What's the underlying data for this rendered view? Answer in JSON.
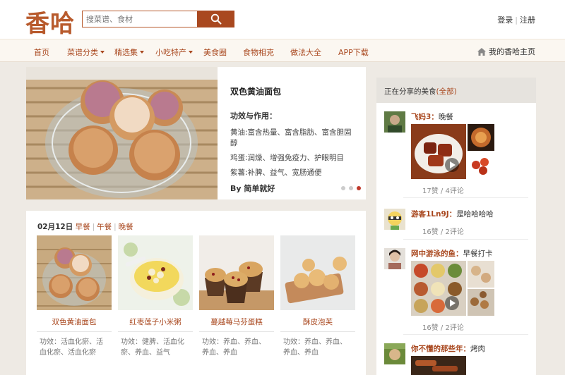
{
  "header": {
    "logo": "香哈",
    "search_placeholder": "搜菜谱、食材",
    "login": "登录",
    "register": "注册"
  },
  "nav": {
    "items": [
      {
        "label": "首页"
      },
      {
        "label": "菜谱分类",
        "dropdown": true
      },
      {
        "label": "精选集",
        "dropdown": true
      },
      {
        "label": "小吃特产",
        "dropdown": true
      },
      {
        "label": "美食圈"
      },
      {
        "label": "食物相克"
      },
      {
        "label": "做法大全"
      },
      {
        "label": "APP下载"
      }
    ],
    "home_link": "我的香哈主页"
  },
  "hero": {
    "title": "双色黄油面包",
    "subtitle": "功效与作用：",
    "lines": [
      "黄油:富含热量、富含脂肪、富含胆固醇",
      "鸡蛋:润燥、增强免疫力、护眼明目",
      "紫薯:补脾、益气、宽肠通便"
    ],
    "author": "By 简单就好",
    "slides": 3,
    "active_slide": 3
  },
  "meals": {
    "date": "02月12日",
    "tabs": [
      "早餐",
      "午餐",
      "晚餐"
    ],
    "items": [
      {
        "name": "双色黄油面包",
        "desc": "功效：活血化瘀、活血化瘀、活血化瘀"
      },
      {
        "name": "红枣莲子小米粥",
        "desc": "功效：健脾、活血化瘀、养血、益气"
      },
      {
        "name": "蔓越莓马芬蛋糕",
        "desc": "功效：养血、养血、养血、养血"
      },
      {
        "name": "酥皮泡芙",
        "desc": "功效：养血、养血、养血、养血"
      }
    ]
  },
  "sidebar": {
    "title": "正在分享的美食",
    "all_link": "(全部)",
    "shares": [
      {
        "user": "飞妈3：",
        "text": "晚餐",
        "likes": "17赞",
        "comments": "4评论"
      },
      {
        "user": "游客1Ln9J：",
        "text": "是哈哈哈哈",
        "likes": "16赞",
        "comments": "2评论"
      },
      {
        "user": "网中游泳的鱼：",
        "text": "早餐打卡",
        "likes": "16赞",
        "comments": "2评论"
      },
      {
        "user": "你不懂的那些年：",
        "text": "烤肉"
      }
    ]
  }
}
